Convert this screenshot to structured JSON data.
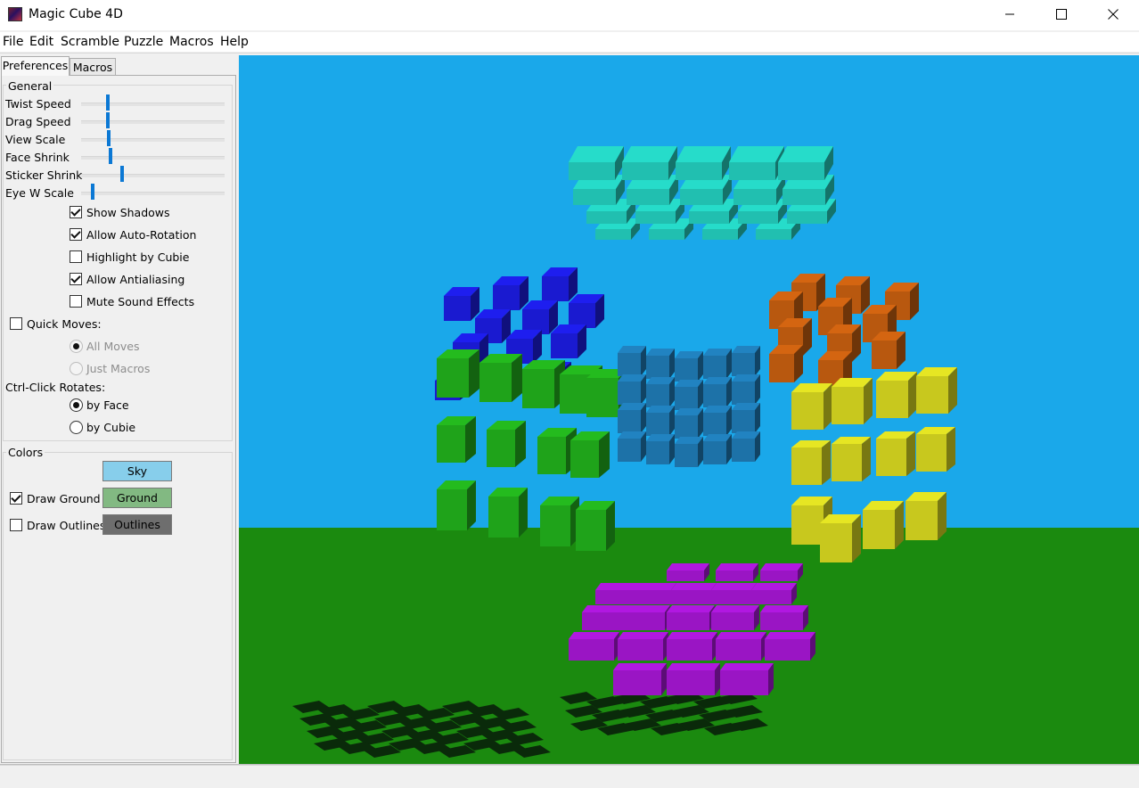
{
  "window": {
    "title": "Magic Cube 4D",
    "icon": "magic-cube-app-icon",
    "controls": [
      "minimize-icon",
      "maximize-icon",
      "close-icon"
    ]
  },
  "menu": [
    "File",
    "Edit",
    "Scramble",
    "Puzzle",
    "Macros",
    "Help"
  ],
  "tabs": {
    "preferences": "Preferences",
    "macros": "Macros",
    "active": "Preferences"
  },
  "general": {
    "title": "General",
    "sliders": [
      {
        "label": "Twist Speed",
        "value": 0.19
      },
      {
        "label": "Drag Speed",
        "value": 0.19
      },
      {
        "label": "View Scale",
        "value": 0.2
      },
      {
        "label": "Face Shrink",
        "value": 0.21
      },
      {
        "label": "Sticker Shrink",
        "value": 0.29
      },
      {
        "label": "Eye W Scale",
        "value": 0.08
      }
    ],
    "checkboxes": [
      {
        "label": "Show Shadows",
        "checked": true
      },
      {
        "label": "Allow Auto-Rotation",
        "checked": true
      },
      {
        "label": "Highlight by Cubie",
        "checked": false
      },
      {
        "label": "Allow Antialiasing",
        "checked": true
      },
      {
        "label": "Mute Sound Effects",
        "checked": false
      }
    ],
    "quick_moves": {
      "label": "Quick Moves:",
      "checked": false,
      "options": [
        {
          "label": "All Moves",
          "selected": true,
          "enabled": false
        },
        {
          "label": "Just Macros",
          "selected": false,
          "enabled": false
        }
      ]
    },
    "ctrl_click": {
      "label": "Ctrl-Click Rotates:",
      "options": [
        {
          "label": "by Face",
          "selected": true
        },
        {
          "label": "by Cubie",
          "selected": false
        }
      ]
    }
  },
  "colors": {
    "title": "Colors",
    "sky": {
      "label": "Sky",
      "color": "#87ceeb"
    },
    "ground": {
      "label": "Ground",
      "color": "#82b982",
      "toggle_label": "Draw Ground",
      "checked": true
    },
    "outlines": {
      "label": "Outlines",
      "color": "#6e6e6e",
      "toggle_label": "Draw Outlines",
      "checked": false
    }
  },
  "view": {
    "sky_color": "#1aa8ea",
    "ground_color": "#1b8a0f",
    "faces": [
      {
        "name": "cyan-face",
        "color": "#21bfb0"
      },
      {
        "name": "blue-face",
        "color": "#1a1ad0"
      },
      {
        "name": "center-teal-face",
        "color": "#1d72a8"
      },
      {
        "name": "orange-face",
        "color": "#b8580f"
      },
      {
        "name": "green-face",
        "color": "#1fa31a"
      },
      {
        "name": "yellow-face",
        "color": "#c8c81e"
      },
      {
        "name": "purple-face",
        "color": "#9a15c4"
      },
      {
        "name": "shadow",
        "color": "#0a2a0a"
      }
    ]
  }
}
